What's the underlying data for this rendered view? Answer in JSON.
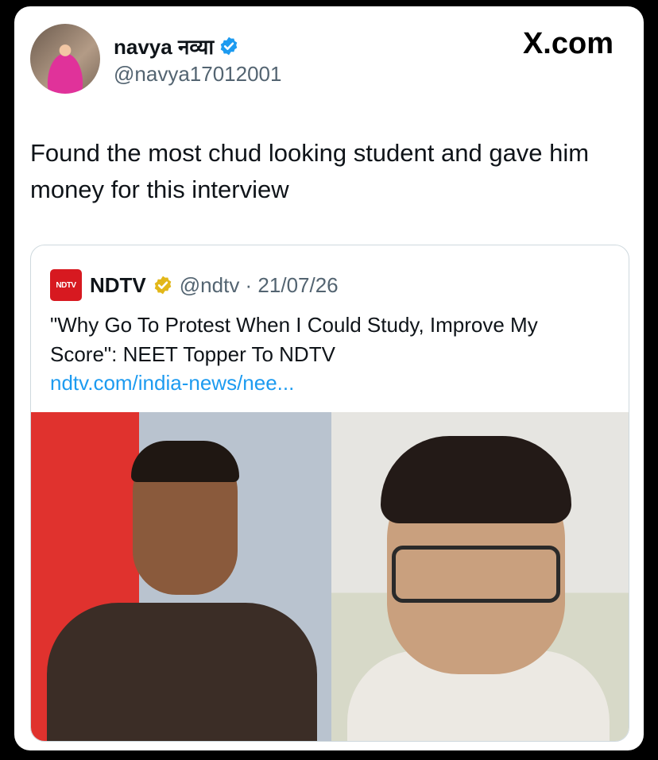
{
  "author": {
    "name": "navya नव्या",
    "handle": "@navya17012001"
  },
  "brand": "X.com",
  "tweet": {
    "text": "Found the most chud looking student and gave him money for this interview"
  },
  "quote": {
    "logo_text": "NDTV",
    "name": "NDTV",
    "meta": "@ndtv · 21/07/26",
    "text": "\"Why Go To Protest When I Could Study, Improve My Score\": NEET Topper To NDTV",
    "link": "ndtv.com/india-news/nee..."
  },
  "colors": {
    "verified_blue": "#1d9bf0",
    "verified_gold": "#e2b719",
    "ndtv_red": "#d71920",
    "link_blue": "#1d9bf0"
  },
  "icons": {
    "verified": "verified-badge-icon",
    "gold_verified": "gold-verified-badge-icon"
  }
}
